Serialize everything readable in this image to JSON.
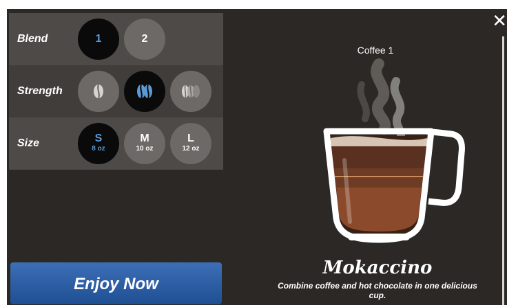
{
  "panel": {
    "blend": {
      "label": "Blend",
      "options": [
        "1",
        "2"
      ],
      "selected": "1"
    },
    "strength": {
      "label": "Strength",
      "options": [
        "mild-bean-icon",
        "medium-beans-icon",
        "strong-beans-icon"
      ],
      "selected": "medium-beans-icon"
    },
    "size": {
      "label": "Size",
      "options": [
        {
          "letter": "S",
          "oz": "8 oz"
        },
        {
          "letter": "M",
          "oz": "10 oz"
        },
        {
          "letter": "L",
          "oz": "12 oz"
        }
      ],
      "selected": "S"
    }
  },
  "enjoy_label": "Enjoy Now",
  "close_icon": "close-icon",
  "coffee_label": "Coffee 1",
  "drink": {
    "name": "Mokaccino",
    "description": "Combine coffee and hot chocolate in one delicious cup."
  },
  "colors": {
    "background": "#2b2825",
    "selected": "#0a0a0a",
    "accent": "#5b9bd5",
    "button": "#2f63ad"
  }
}
